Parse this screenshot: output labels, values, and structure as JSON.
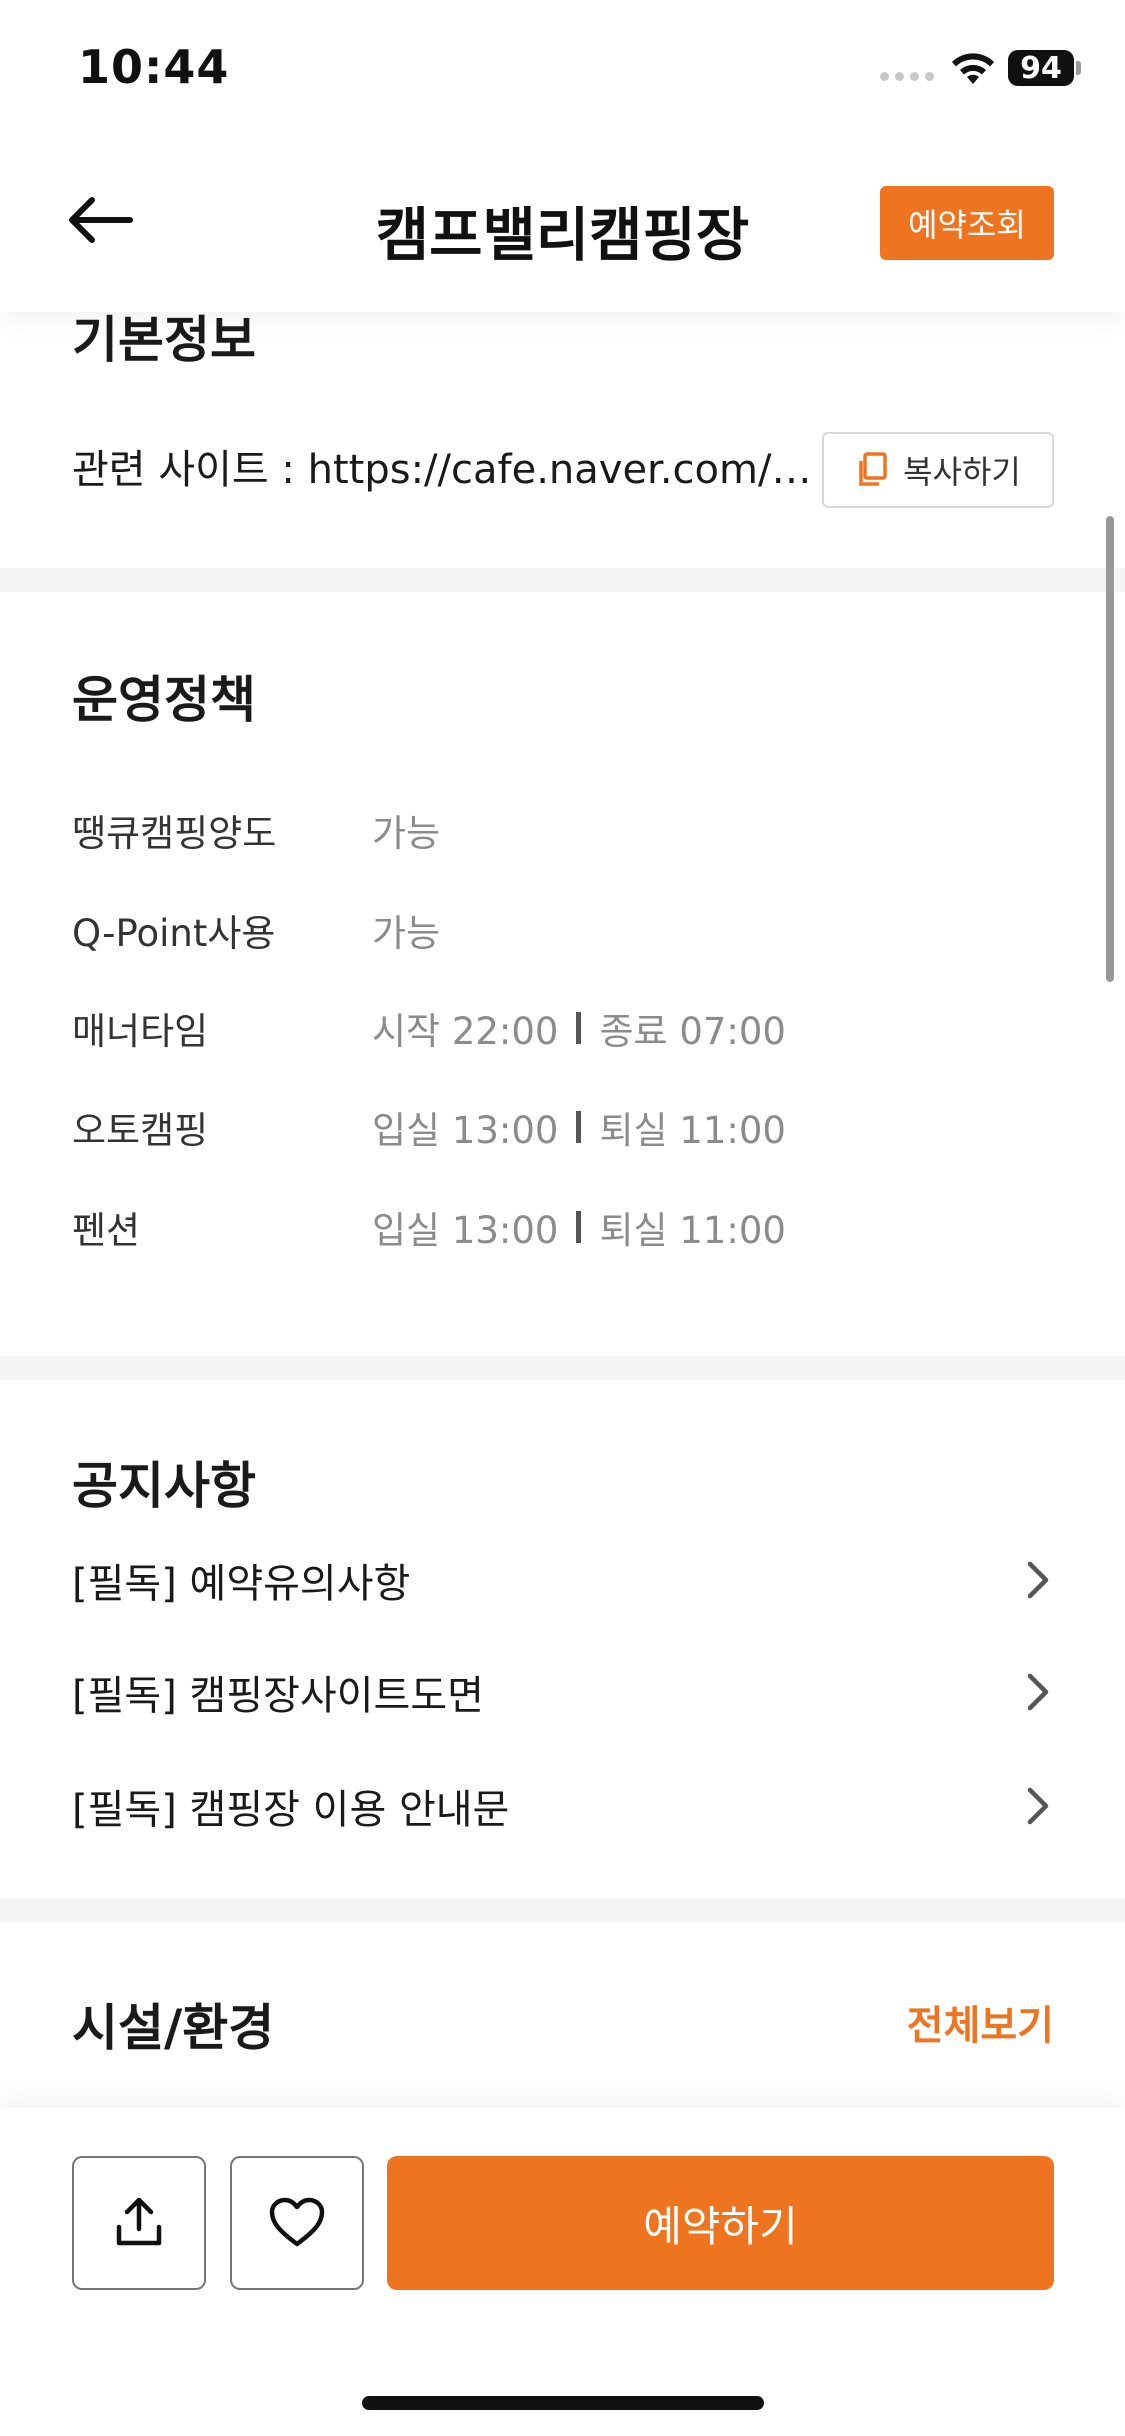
{
  "status_bar": {
    "time": "10:44",
    "battery": "94"
  },
  "header": {
    "title": "캠프밸리캠핑장",
    "reserve_check_label": "예약조회"
  },
  "basic_info": {
    "title": "기본정보",
    "site_label": "관련 사이트 : https://cafe.naver.com/pur…",
    "copy_label": "복사하기"
  },
  "policy": {
    "title": "운영정책",
    "rows": [
      {
        "label": "땡큐캠핑양도",
        "value": "가능"
      },
      {
        "label": "Q-Point사용",
        "value": "가능"
      },
      {
        "label": "매너타임",
        "value_a": "시작 22:00",
        "value_b": "종료 07:00"
      },
      {
        "label": "오토캠핑",
        "value_a": "입실 13:00",
        "value_b": "퇴실 11:00"
      },
      {
        "label": "펜션",
        "value_a": "입실 13:00",
        "value_b": "퇴실 11:00"
      }
    ]
  },
  "notices": {
    "title": "공지사항",
    "items": [
      {
        "label": "[필독] 예약유의사항"
      },
      {
        "label": "[필독] 캠핑장사이트도면"
      },
      {
        "label": "[필독] 캠핑장 이용 안내문"
      }
    ]
  },
  "facilities": {
    "title": "시설/환경",
    "view_all_label": "전체보기"
  },
  "bottom_bar": {
    "share_icon": "share-icon",
    "like_icon": "heart-icon",
    "reserve_label": "예약하기"
  },
  "colors": {
    "accent": "#ee7420",
    "divider": "#f5f5f5"
  }
}
